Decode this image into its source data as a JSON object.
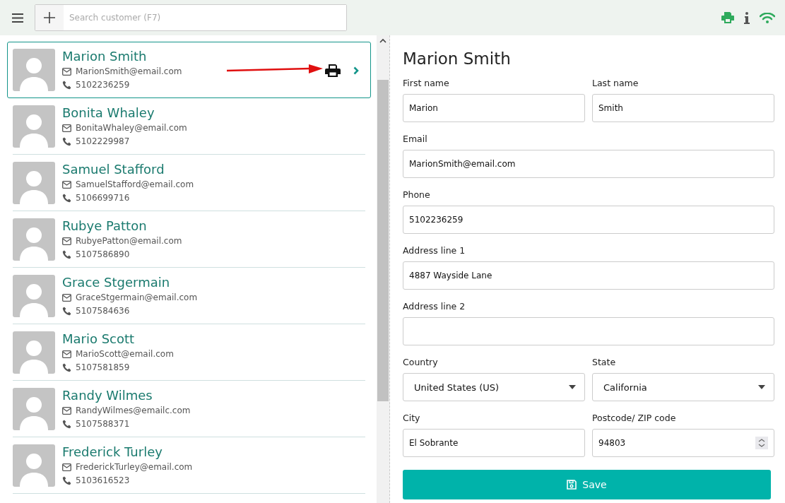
{
  "search": {
    "placeholder": "Search customer (F7)"
  },
  "customers": [
    {
      "name": "Marion Smith",
      "email": "MarionSmith@email.com",
      "phone": "5102236259",
      "selected": true
    },
    {
      "name": "Bonita Whaley",
      "email": "BonitaWhaley@email.com",
      "phone": "5102229987",
      "selected": false
    },
    {
      "name": "Samuel Stafford",
      "email": "SamuelStafford@email.com",
      "phone": "5106699716",
      "selected": false
    },
    {
      "name": "Rubye Patton",
      "email": "RubyePatton@email.com",
      "phone": "5107586890",
      "selected": false
    },
    {
      "name": "Grace Stgermain",
      "email": "GraceStgermain@email.com",
      "phone": "5107584636",
      "selected": false
    },
    {
      "name": "Mario Scott",
      "email": "MarioScott@email.com",
      "phone": "5107581859",
      "selected": false
    },
    {
      "name": "Randy Wilmes",
      "email": "RandyWilmes@emailc.com",
      "phone": "5107588371",
      "selected": false
    },
    {
      "name": "Frederick Turley",
      "email": "FrederickTurley@email.com",
      "phone": "5103616523",
      "selected": false
    }
  ],
  "detail": {
    "title": "Marion Smith",
    "rows": [
      [
        {
          "label": "First name",
          "value": "Marion",
          "kind": "text"
        },
        {
          "label": "Last name",
          "value": "Smith",
          "kind": "text"
        }
      ],
      [
        {
          "label": "Email",
          "value": "MarionSmith@email.com",
          "kind": "text"
        }
      ],
      [
        {
          "label": "Phone",
          "value": "5102236259",
          "kind": "text"
        }
      ],
      [
        {
          "label": "Address line 1",
          "value": "4887 Wayside Lane",
          "kind": "text"
        }
      ],
      [
        {
          "label": "Address line 2",
          "kind": "text"
        }
      ],
      [
        {
          "label": "Country",
          "value": "United States (US)",
          "kind": "select"
        },
        {
          "label": "State",
          "value": "California",
          "kind": "select"
        }
      ],
      [
        {
          "label": "City",
          "value": "El Sobrante",
          "kind": "text"
        },
        {
          "label": "Postcode/ ZIP code",
          "value": "94803",
          "kind": "number"
        }
      ]
    ],
    "save_button": "Save"
  }
}
